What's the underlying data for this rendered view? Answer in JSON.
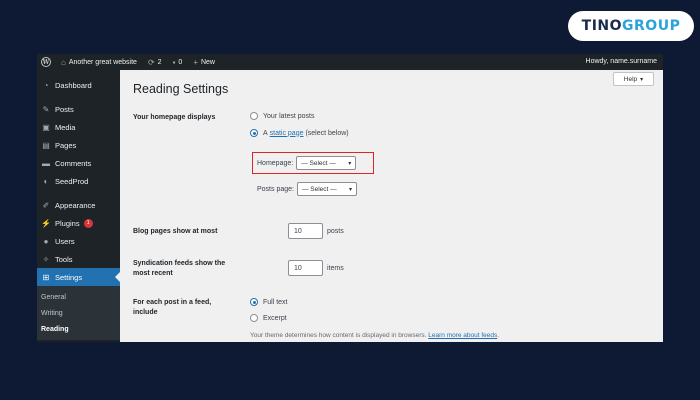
{
  "brand": {
    "part1": "TINO",
    "part2": "GROUP"
  },
  "adminbar": {
    "site_name": "Another great website",
    "updates_count": "2",
    "comments_count": "0",
    "new_label": "New",
    "howdy": "Howdy, name.surname"
  },
  "sidebar": {
    "items": [
      {
        "label": "Dashboard",
        "icon": "dashboard-icon"
      },
      {
        "label": "Posts",
        "icon": "pin-icon"
      },
      {
        "label": "Media",
        "icon": "media-icon"
      },
      {
        "label": "Pages",
        "icon": "pages-icon"
      },
      {
        "label": "Comments",
        "icon": "comment-icon"
      },
      {
        "label": "SeedProd",
        "icon": "seedprod-icon"
      },
      {
        "label": "Appearance",
        "icon": "brush-icon"
      },
      {
        "label": "Plugins",
        "icon": "plugin-icon",
        "badge": "1"
      },
      {
        "label": "Users",
        "icon": "users-icon"
      },
      {
        "label": "Tools",
        "icon": "wrench-icon"
      },
      {
        "label": "Settings",
        "icon": "settings-icon"
      }
    ],
    "submenu": [
      "General",
      "Writing",
      "Reading"
    ]
  },
  "help": {
    "label": "Help"
  },
  "page": {
    "title": "Reading Settings",
    "homepage_displays": {
      "label": "Your homepage displays",
      "opt_latest": "Your latest posts",
      "opt_static_prefix": "A",
      "opt_static_link": "static page",
      "opt_static_suffix": "(select below)",
      "homepage_label": "Homepage:",
      "homepage_value": "— Select —",
      "posts_page_label": "Posts page:",
      "posts_page_value": "— Select —"
    },
    "blog_pages": {
      "label": "Blog pages show at most",
      "value": "10",
      "unit": "posts"
    },
    "syndication": {
      "label_line1": "Syndication feeds show the",
      "label_line2": "most recent",
      "value": "10",
      "unit": "items"
    },
    "feed_include": {
      "label_line1": "For each post in a feed,",
      "label_line2": "include",
      "opt_full": "Full text",
      "opt_excerpt": "Excerpt",
      "desc": "Your theme determines how content is displayed in browsers.",
      "desc_link": "Learn more about feeds"
    }
  },
  "colors": {
    "accent": "#2271b1",
    "sidebar_bg": "#1d2327",
    "highlight": "#e02424",
    "page_bg": "#0e1a33"
  }
}
